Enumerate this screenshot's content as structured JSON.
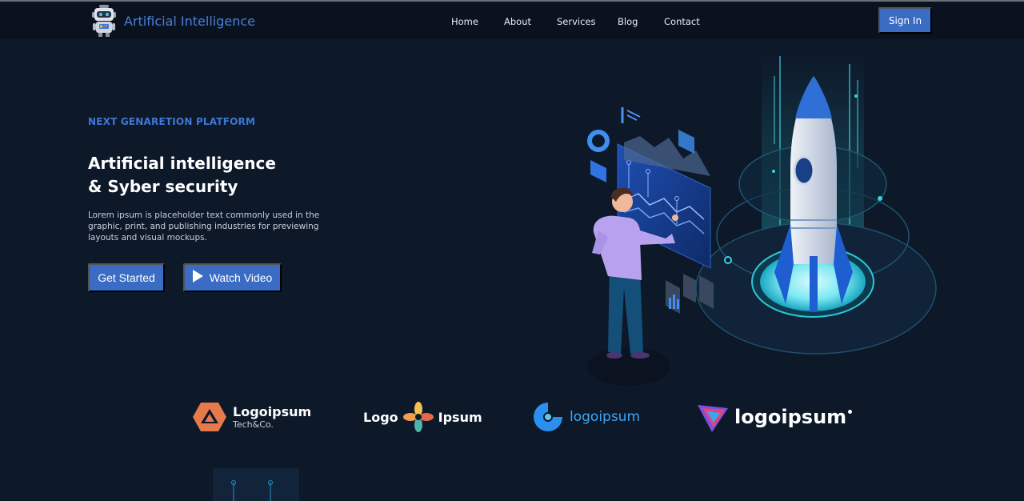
{
  "nav": {
    "brand": "Artificial Intelligence",
    "links": [
      "Home",
      "About",
      "Services",
      "Blog",
      "Contact"
    ],
    "signin": "Sign In"
  },
  "hero": {
    "eyebrow": "NEXT GENARETION PLATFORM",
    "title_line1": "Artificial intelligence",
    "title_line2": "& Syber security",
    "description": "Lorem ipsum is placeholder text commonly used in the graphic, print, and publishing industries for previewing layouts and visual mockups.",
    "cta_primary": "Get Started",
    "cta_secondary": "Watch Video"
  },
  "logos": [
    {
      "name": "Logoipsum",
      "sub": "Tech&Co."
    },
    {
      "name_left": "Logo",
      "name_right": "Ipsum"
    },
    {
      "name": "logoipsum"
    },
    {
      "name": "logoipsum"
    }
  ],
  "colors": {
    "background": "#0d1829",
    "navbar": "#0a1220",
    "accent": "#3a6cc4",
    "brand_text": "#4a7fd6",
    "cyan_glow": "#5ee1e8"
  }
}
